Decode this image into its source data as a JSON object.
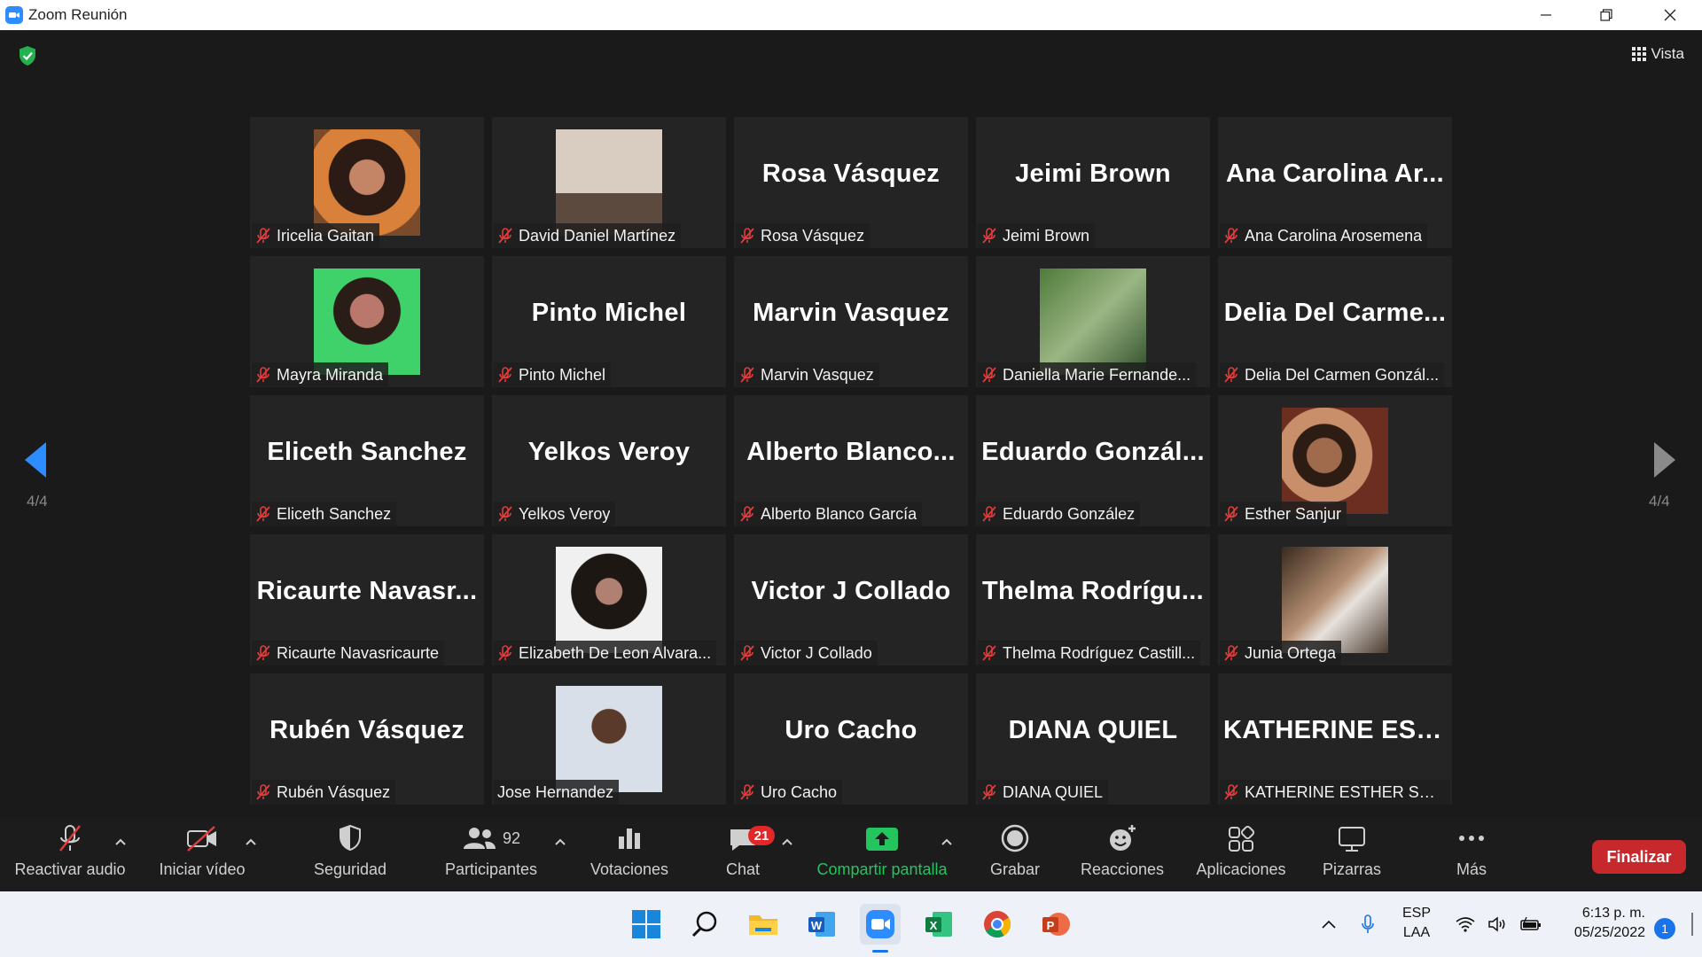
{
  "window": {
    "title": "Zoom Reunión",
    "icon": "zoom-app-icon",
    "controls": [
      "minimize-icon",
      "restore-icon",
      "close-icon"
    ]
  },
  "meeting": {
    "security_indicator_icon": "shield-check-icon",
    "view_label": "Vista",
    "page_left": "4/4",
    "page_right": "4/4",
    "accent_color": "#2d8cff",
    "muted_color": "#e03c3c"
  },
  "participants": [
    {
      "display": "Iricelia Gaitan",
      "video": "photo",
      "muted": true
    },
    {
      "display": "David Daniel Martínez",
      "video": "photo",
      "muted": true
    },
    {
      "display": "Rosa Vásquez",
      "big": "Rosa Vásquez",
      "muted": true
    },
    {
      "display": "Jeimi Brown",
      "big": "Jeimi Brown",
      "muted": true
    },
    {
      "display": "Ana Carolina Arosemena",
      "big": "Ana Carolina Ar...",
      "muted": true
    },
    {
      "display": "Mayra Miranda",
      "video": "photo",
      "muted": true
    },
    {
      "display": "Pinto Michel",
      "big": "Pinto Michel",
      "muted": true
    },
    {
      "display": "Marvin Vasquez",
      "big": "Marvin Vasquez",
      "muted": true
    },
    {
      "display": "Daniella Marie Fernande...",
      "video": "photo",
      "muted": true
    },
    {
      "display": "Delia Del Carmen Gonzál...",
      "big": "Delia Del Carme...",
      "muted": true
    },
    {
      "display": "Eliceth Sanchez",
      "big": "Eliceth Sanchez",
      "muted": true
    },
    {
      "display": "Yelkos Veroy",
      "big": "Yelkos Veroy",
      "muted": true
    },
    {
      "display": "Alberto Blanco García",
      "big": "Alberto Blanco...",
      "muted": true
    },
    {
      "display": "Eduardo González",
      "big": "Eduardo Gonzál...",
      "muted": true
    },
    {
      "display": "Esther Sanjur",
      "video": "photo",
      "muted": true
    },
    {
      "display": "Ricaurte Navasricaurte",
      "big": "Ricaurte Navasr...",
      "muted": true
    },
    {
      "display": "Elizabeth De Leon Alvara...",
      "video": "photo",
      "muted": true
    },
    {
      "display": "Victor J Collado",
      "big": "Victor J Collado",
      "muted": true
    },
    {
      "display": "Thelma Rodríguez Castill...",
      "big": "Thelma Rodrígu...",
      "muted": true
    },
    {
      "display": "Junia Ortega",
      "video": "photo",
      "muted": true
    },
    {
      "display": "Rubén Vásquez",
      "big": "Rubén Vásquez",
      "muted": true
    },
    {
      "display": "Jose Hernandez",
      "video": "photo",
      "muted": false
    },
    {
      "display": "Uro Cacho",
      "big": "Uro Cacho",
      "muted": true
    },
    {
      "display": "DIANA QUIEL",
      "big": "DIANA QUIEL",
      "muted": true
    },
    {
      "display": "KATHERINE ESTHER SAEN...",
      "big": "KATHERINE EST...",
      "muted": true
    }
  ],
  "toolbar": {
    "audio_label": "Reactivar audio",
    "video_label": "Iniciar vídeo",
    "security_label": "Seguridad",
    "participants_label": "Participantes",
    "participants_count": "92",
    "polls_label": "Votaciones",
    "chat_label": "Chat",
    "chat_badge": "21",
    "share_label": "Compartir pantalla",
    "record_label": "Grabar",
    "reactions_label": "Reacciones",
    "apps_label": "Aplicaciones",
    "whiteboards_label": "Pizarras",
    "more_label": "Más",
    "end_label": "Finalizar",
    "share_color": "#22c55e",
    "end_color": "#c7282c"
  },
  "taskbar": {
    "apps": [
      "windows-start-icon",
      "search-icon",
      "file-explorer-icon",
      "word-icon",
      "zoom-icon",
      "excel-icon",
      "chrome-icon",
      "powerpoint-icon"
    ],
    "lang_top": "ESP",
    "lang_bottom": "LAA",
    "time": "6:13 p. m.",
    "date": "05/25/2022",
    "notifications": "1"
  }
}
